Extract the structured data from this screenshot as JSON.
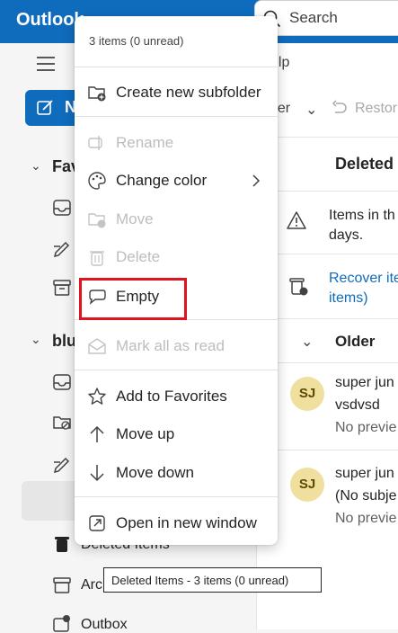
{
  "app": {
    "brand": "Outlook"
  },
  "search": {
    "placeholder": "Search"
  },
  "ribbon": {
    "help_tab": "elp",
    "toolbar_left": "der",
    "restore": "Restor"
  },
  "sidebar": {
    "new_label": "N",
    "groups": [
      {
        "label": "Fav"
      },
      {
        "label": "blu"
      }
    ],
    "rows": [
      {
        "label": "Deleted Items"
      },
      {
        "label": "Arc"
      },
      {
        "label": "Outbox"
      }
    ],
    "selected_more": "···"
  },
  "main": {
    "header": "Deleted",
    "info_line1": "Items in th",
    "info_line2": "days.",
    "recover_line1": "Recover ite",
    "recover_line2": "items)",
    "group": "Older",
    "mails": [
      {
        "initials": "SJ",
        "sender": "super jun",
        "subject": "vsdvsd",
        "preview": "No previe"
      },
      {
        "initials": "SJ",
        "sender": "super jun",
        "subject": "(No subje",
        "preview": "No previe"
      }
    ]
  },
  "context_menu": {
    "header": "3 items (0 unread)",
    "items": [
      {
        "label": "Create new subfolder",
        "icon": "folder-add-icon"
      },
      {
        "label": "Rename",
        "icon": "rename-icon"
      },
      {
        "label": "Change color",
        "icon": "palette-icon"
      },
      {
        "label": "Move",
        "icon": "folder-move-icon"
      },
      {
        "label": "Delete",
        "icon": "trash-icon"
      },
      {
        "label": "Empty",
        "icon": "eraser-icon"
      },
      {
        "label": "Mark all as read",
        "icon": "mail-read-icon"
      },
      {
        "label": "Add to Favorites",
        "icon": "star-icon"
      },
      {
        "label": "Move up",
        "icon": "arrow-up-icon"
      },
      {
        "label": "Move down",
        "icon": "arrow-down-icon"
      },
      {
        "label": "Open in new window",
        "icon": "open-window-icon"
      }
    ]
  },
  "tooltip": {
    "text": "Deleted Items - 3 items (0 unread)"
  },
  "colors": {
    "brand": "#0f6cbd",
    "highlight": "#e0141e",
    "avatar": "#efe0a0"
  }
}
